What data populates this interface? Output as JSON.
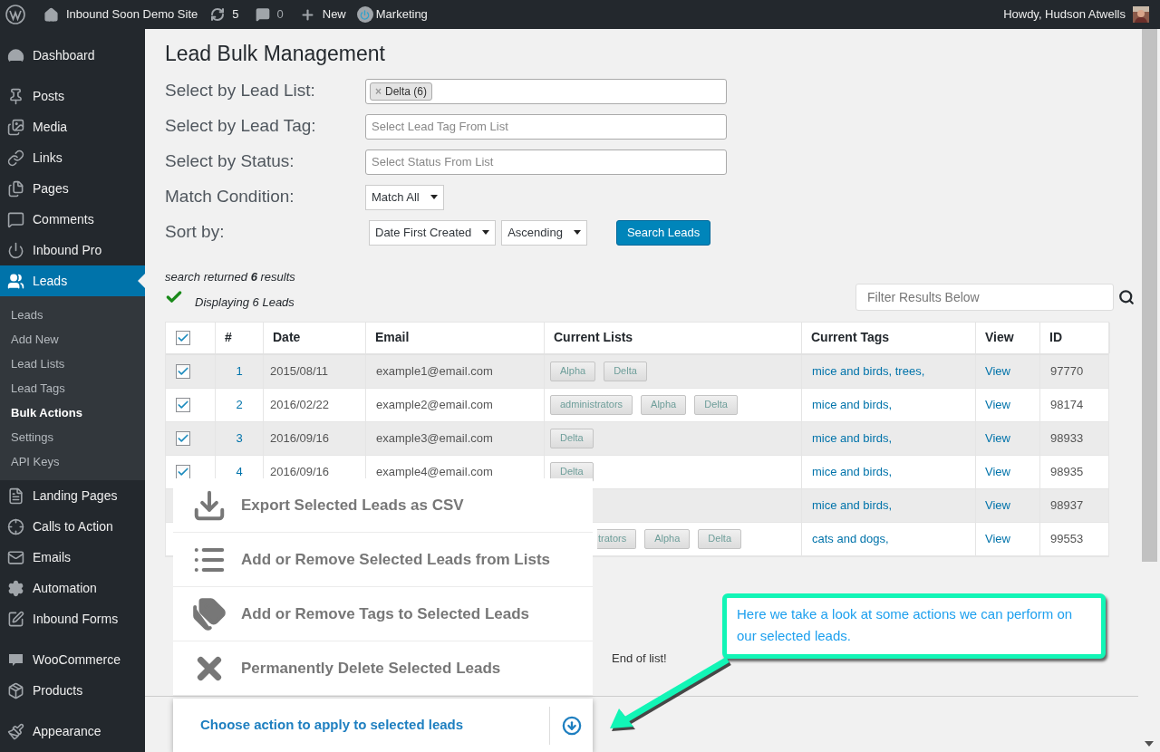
{
  "admin_bar": {
    "site": "Inbound Soon Demo Site",
    "updates": "5",
    "comments": "0",
    "new": "New",
    "marketing": "Marketing",
    "greeting": "Howdy, Hudson Atwells"
  },
  "sidebar": {
    "groups": [
      [
        {
          "label": "Dashboard",
          "selected": false
        }
      ],
      [
        {
          "label": "Posts",
          "selected": false
        },
        {
          "label": "Media",
          "selected": false
        },
        {
          "label": "Links",
          "selected": false
        },
        {
          "label": "Pages",
          "selected": false
        },
        {
          "label": "Comments",
          "selected": false
        },
        {
          "label": "Inbound Pro",
          "selected": false
        },
        {
          "label": "Leads",
          "selected": true,
          "children": [
            {
              "label": "Leads",
              "selected": false
            },
            {
              "label": "Add New",
              "selected": false
            },
            {
              "label": "Lead Lists",
              "selected": false
            },
            {
              "label": "Lead Tags",
              "selected": false
            },
            {
              "label": "Bulk Actions",
              "selected": true
            },
            {
              "label": "Settings",
              "selected": false
            },
            {
              "label": "API Keys",
              "selected": false
            }
          ]
        },
        {
          "label": "Landing Pages",
          "selected": false
        },
        {
          "label": "Calls to Action",
          "selected": false
        },
        {
          "label": "Emails",
          "selected": false
        },
        {
          "label": "Automation",
          "selected": false
        },
        {
          "label": "Inbound Forms",
          "selected": false
        }
      ],
      [
        {
          "label": "WooCommerce",
          "selected": false
        },
        {
          "label": "Products",
          "selected": false
        }
      ],
      [
        {
          "label": "Appearance",
          "selected": false
        }
      ]
    ]
  },
  "page": {
    "title": "Lead Bulk Management",
    "filters": [
      {
        "label": "Select by Lead List:",
        "kind": "tags",
        "tags": [
          {
            "label": "Delta (6)",
            "remove": "×"
          }
        ]
      },
      {
        "label": "Select by Lead Tag:",
        "kind": "text",
        "placeholder": "Select Lead Tag From List"
      },
      {
        "label": "Select by Status:",
        "kind": "text",
        "placeholder": "Select Status From List"
      },
      {
        "label": "Match Condition:",
        "kind": "select",
        "selects": [
          "Match All"
        ]
      },
      {
        "label": "Sort by:",
        "kind": "select",
        "selects": [
          "Date First Created",
          "Ascending"
        ],
        "button": "Search Leads"
      }
    ],
    "search_summary": "search returned **6** results",
    "displaying": "Displaying 6 Leads",
    "filter_placeholder": "Filter Results Below",
    "table": {
      "select_all": {
        "checked": true
      },
      "columns": [
        "#",
        "Date",
        "Email",
        "Current Lists",
        "Current Tags",
        "View",
        "ID"
      ],
      "rows": [
        {
          "checked": true,
          "number": "1",
          "date": "2015/08/11",
          "email": "example1@email.com",
          "lists": [
            {
              "label": "Alpha"
            },
            {
              "label": "Delta"
            }
          ],
          "tags": "mice and birds, trees,",
          "view": "View",
          "id": "97770"
        },
        {
          "checked": true,
          "number": "2",
          "date": "2016/02/22",
          "email": "example2@email.com",
          "lists": [
            {
              "label": "administrators"
            },
            {
              "label": "Alpha"
            },
            {
              "label": "Delta"
            }
          ],
          "tags": "mice and birds,",
          "view": "View",
          "id": "98174"
        },
        {
          "checked": true,
          "number": "3",
          "date": "2016/09/16",
          "email": "example3@email.com",
          "lists": [
            {
              "label": "Delta"
            }
          ],
          "tags": "mice and birds,",
          "view": "View",
          "id": "98933"
        },
        {
          "checked": true,
          "number": "4",
          "date": "2016/09/16",
          "email": "example4@email.com",
          "lists": [
            {
              "label": "Delta"
            }
          ],
          "tags": "mice and birds,",
          "view": "View",
          "id": "98935"
        },
        {
          "tags": "mice and birds,",
          "view": "View",
          "id": "98937"
        },
        {
          "lists": [
            {
              "label": "trators",
              "clipped": true
            },
            {
              "label": "Alpha"
            },
            {
              "label": "Delta"
            }
          ],
          "tags": "cats and dogs,",
          "view": "View",
          "id": "99553"
        }
      ]
    },
    "end_of_list": "End of list!",
    "actions": [
      {
        "label": "Export Selected Leads as CSV"
      },
      {
        "label": "Add or Remove Selected Leads from Lists"
      },
      {
        "label": "Add or Remove Tags to Selected Leads"
      },
      {
        "label": "Permanently Delete Selected Leads"
      }
    ],
    "chooser": "Choose action to apply to selected leads",
    "callout": "Here we take a look at some actions we can perform on our selected leads."
  }
}
